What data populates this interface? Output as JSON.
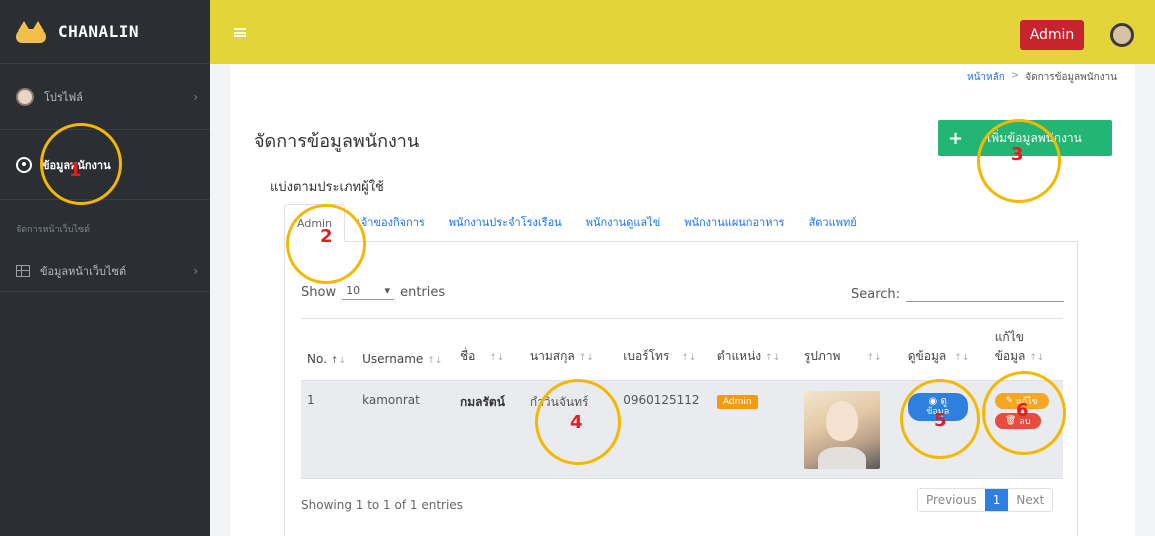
{
  "brand": {
    "name": "CHANALIN"
  },
  "sidebar": {
    "items": [
      {
        "label": "โปรไฟล์",
        "icon": "avatar-icon"
      },
      {
        "label": "ข้อมูลพนักงาน",
        "icon": "user-circle-icon"
      },
      {
        "label": "จัดการหน้าเว็บไซต์"
      },
      {
        "label": "ข้อมูลหน้าเว็บไซต์",
        "icon": "grid-icon"
      }
    ]
  },
  "topbar": {
    "admin_label": "Admin"
  },
  "breadcrumb": {
    "home": "หน้าหลัก",
    "sep": ">",
    "current": "จัดการข้อมูลพนักงาน"
  },
  "page": {
    "title": "จัดการข้อมูลพนักงาน",
    "add_button": "เพิ่มข้อมูลพนักงาน",
    "add_plus": "+",
    "sub_title": "แบ่งตามประเภทผู้ใช้"
  },
  "tabs": [
    "Admin",
    "เจ้าของกิจการ",
    "พนักงานประจำโรงเรือน",
    "พนักงานดูแลไข่",
    "พนักงานแผนกอาหาร",
    "สัตวแพทย์"
  ],
  "table_controls": {
    "show": "Show",
    "entries_value": "10",
    "entries": "entries",
    "search": "Search:"
  },
  "table": {
    "headers": [
      "No.",
      "Username",
      "ชื่อ",
      "นามสกุล",
      "เบอร์โทร",
      "ตำแหน่ง",
      "รูปภาพ",
      "ดูข้อมูล",
      "แก้ไข ข้อมูล"
    ],
    "rows": [
      {
        "no": "1",
        "username": "kamonrat",
        "name": "กมลรัตน์",
        "surname": "กำวินจันทร์",
        "phone": "0960125112",
        "position": "Admin",
        "view_label_1": "ดู",
        "view_label_2": "ข้อมูล",
        "edit_label": "แก้ไข",
        "delete_label": "ลบ"
      }
    ]
  },
  "footer": {
    "info": "Showing 1 to 1 of 1 entries",
    "prev": "Previous",
    "page": "1",
    "next": "Next"
  },
  "annotations": [
    "1",
    "2",
    "3",
    "4",
    "5",
    "6"
  ],
  "colors": {
    "topbar": "#e3d439",
    "sidebar": "#2b2f33",
    "annotation_ring": "#f5b800",
    "annotation_number": "#e31e1e"
  }
}
